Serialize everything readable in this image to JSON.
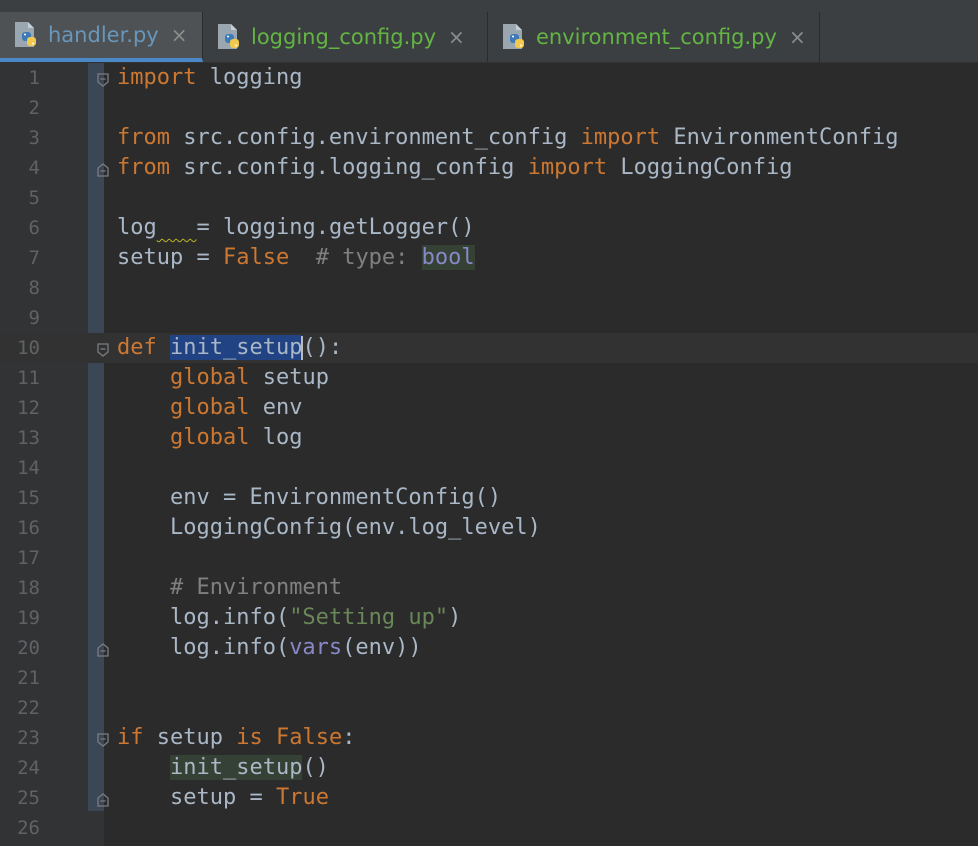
{
  "tabs": [
    {
      "label": "handler.py",
      "active": true,
      "color": "#6897bb",
      "close": "×",
      "icon": "python-file-icon"
    },
    {
      "label": "logging_config.py",
      "active": false,
      "color": "#62b543",
      "close": "×",
      "icon": "python-file-icon"
    },
    {
      "label": "environment_config.py",
      "active": false,
      "color": "#62b543",
      "close": "×",
      "icon": "python-file-icon"
    }
  ],
  "editor": {
    "current_line": 10,
    "lines": [
      {
        "n": "1",
        "tokens": [
          [
            "kw",
            "import"
          ],
          [
            "t",
            " logging"
          ]
        ],
        "fold": "open"
      },
      {
        "n": "2",
        "tokens": []
      },
      {
        "n": "3",
        "tokens": [
          [
            "kw",
            "from"
          ],
          [
            "t",
            " src.config.environment_config "
          ],
          [
            "kw",
            "import"
          ],
          [
            "t",
            " EnvironmentConfig"
          ]
        ]
      },
      {
        "n": "4",
        "tokens": [
          [
            "kw",
            "from"
          ],
          [
            "t",
            " src.config.logging_config "
          ],
          [
            "kw",
            "import"
          ],
          [
            "t",
            " LoggingConfig"
          ]
        ],
        "fold": "close"
      },
      {
        "n": "5",
        "tokens": []
      },
      {
        "n": "6",
        "tokens": [
          [
            "t",
            "log"
          ],
          [
            "warn",
            "   "
          ],
          [
            "t",
            "= logging.getLogger()"
          ]
        ]
      },
      {
        "n": "7",
        "tokens": [
          [
            "t",
            "setup = "
          ],
          [
            "kw",
            "False"
          ],
          [
            "t",
            "  "
          ],
          [
            "cmt",
            "# type: "
          ],
          [
            "type-hl",
            "bool"
          ]
        ]
      },
      {
        "n": "8",
        "tokens": []
      },
      {
        "n": "9",
        "tokens": []
      },
      {
        "n": "10",
        "tokens": [
          [
            "kw",
            "def"
          ],
          [
            "t",
            " "
          ],
          [
            "sel",
            "init_setup"
          ],
          [
            "caret",
            ""
          ],
          [
            "t",
            "():"
          ]
        ],
        "fold": "open"
      },
      {
        "n": "11",
        "tokens": [
          [
            "t",
            "    "
          ],
          [
            "kw",
            "global"
          ],
          [
            "t",
            " setup"
          ]
        ]
      },
      {
        "n": "12",
        "tokens": [
          [
            "t",
            "    "
          ],
          [
            "kw",
            "global"
          ],
          [
            "t",
            " env"
          ]
        ]
      },
      {
        "n": "13",
        "tokens": [
          [
            "t",
            "    "
          ],
          [
            "kw",
            "global"
          ],
          [
            "t",
            " log"
          ]
        ]
      },
      {
        "n": "14",
        "tokens": []
      },
      {
        "n": "15",
        "tokens": [
          [
            "t",
            "    env = EnvironmentConfig()"
          ]
        ]
      },
      {
        "n": "16",
        "tokens": [
          [
            "t",
            "    LoggingConfig(env.log_level)"
          ]
        ]
      },
      {
        "n": "17",
        "tokens": []
      },
      {
        "n": "18",
        "tokens": [
          [
            "t",
            "    "
          ],
          [
            "cmt",
            "# Environment"
          ]
        ]
      },
      {
        "n": "19",
        "tokens": [
          [
            "t",
            "    log.info("
          ],
          [
            "str",
            "\"Setting up\""
          ],
          [
            "t",
            ")"
          ]
        ]
      },
      {
        "n": "20",
        "tokens": [
          [
            "t",
            "    log.info("
          ],
          [
            "builtin",
            "vars"
          ],
          [
            "t",
            "(env))"
          ]
        ],
        "fold": "close"
      },
      {
        "n": "21",
        "tokens": []
      },
      {
        "n": "22",
        "tokens": []
      },
      {
        "n": "23",
        "tokens": [
          [
            "kw",
            "if"
          ],
          [
            "t",
            " setup "
          ],
          [
            "kw",
            "is"
          ],
          [
            "t",
            " "
          ],
          [
            "kw",
            "False"
          ],
          [
            "t",
            ":"
          ]
        ],
        "fold": "open"
      },
      {
        "n": "24",
        "tokens": [
          [
            "t",
            "    "
          ],
          [
            "usage",
            "init_setup"
          ],
          [
            "t",
            "()"
          ]
        ]
      },
      {
        "n": "25",
        "tokens": [
          [
            "t",
            "    setup = "
          ],
          [
            "kw",
            "True"
          ]
        ],
        "fold": "close"
      },
      {
        "n": "26",
        "tokens": []
      }
    ]
  }
}
